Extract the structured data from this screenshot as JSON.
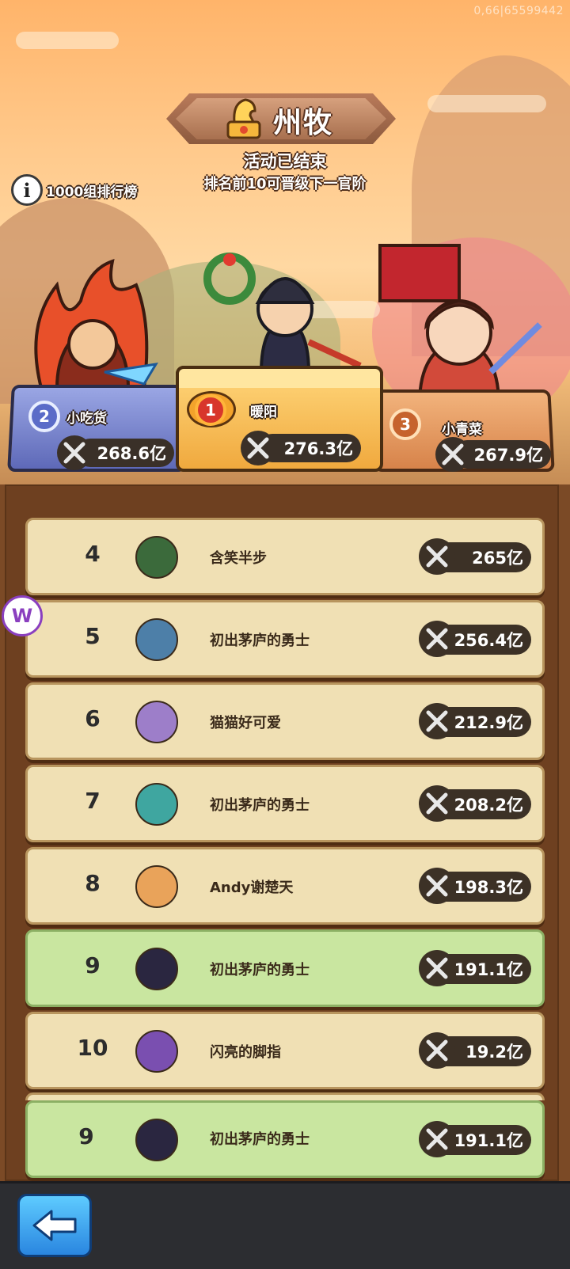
{
  "debug": "0,66|65599442",
  "header": {
    "title": "州牧",
    "status": "活动已结束",
    "subtitle": "排名前10可晋级下一官阶",
    "info_label": "1000组排行榜"
  },
  "podium": [
    {
      "rank": "2",
      "name": "小吃货",
      "score": "268.6亿"
    },
    {
      "rank": "1",
      "name": "暖阳",
      "score": "276.3亿"
    },
    {
      "rank": "3",
      "name": "小青菜",
      "score": "267.9亿"
    }
  ],
  "list": [
    {
      "rank": "4",
      "name": "含笑半步",
      "score": "265亿",
      "highlight": false
    },
    {
      "rank": "5",
      "name": "初出茅庐的勇士",
      "score": "256.4亿",
      "highlight": false
    },
    {
      "rank": "6",
      "name": "猫猫好可爱",
      "score": "212.9亿",
      "highlight": false
    },
    {
      "rank": "7",
      "name": "初出茅庐的勇士",
      "score": "208.2亿",
      "highlight": false
    },
    {
      "rank": "8",
      "name": "Andy谢楚天",
      "score": "198.3亿",
      "highlight": false
    },
    {
      "rank": "9",
      "name": "初出茅庐的勇士",
      "score": "191.1亿",
      "highlight": true
    },
    {
      "rank": "10",
      "name": "闪亮的脚指",
      "score": "19.2亿",
      "highlight": false
    }
  ],
  "self_row": {
    "rank": "9",
    "name": "初出茅庐的勇士",
    "score": "191.1亿"
  },
  "floater_label": "W",
  "icons": {
    "info": "info-icon",
    "sword": "crossed-swords-icon",
    "back": "back-arrow-icon"
  }
}
